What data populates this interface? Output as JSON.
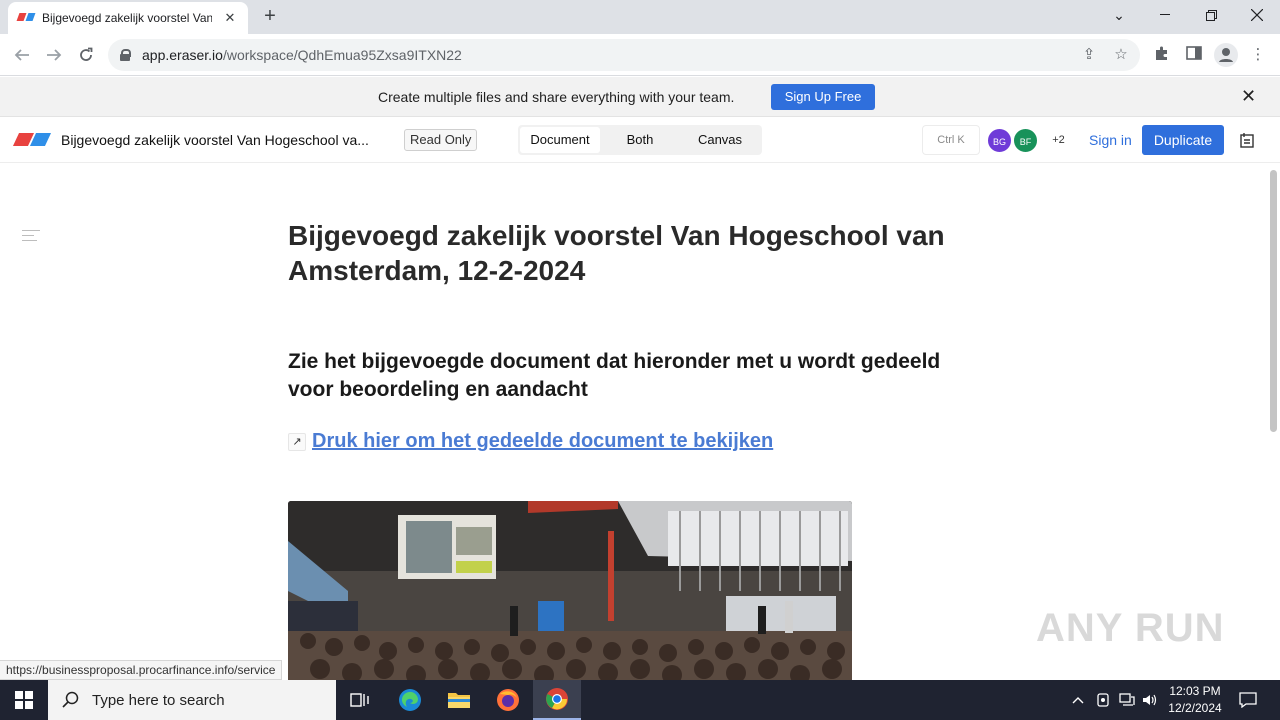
{
  "browser": {
    "tab_title": "Bijgevoegd zakelijk voorstel Van",
    "url_host": "app.eraser.io",
    "url_path": "/workspace/QdhEmua95Zxsa9ITXN22",
    "status_url": "https://businessproposal.procarfinance.info/service"
  },
  "banner": {
    "text": "Create multiple files and share everything with your team.",
    "signup_label": "Sign Up Free"
  },
  "app_header": {
    "doc_title": "Bijgevoegd zakelijk voorstel Van Hogeschool va...",
    "readonly_label": "Read Only",
    "views": [
      "Document",
      "Both",
      "Canvas"
    ],
    "active_view": "Document",
    "shortcut": "Ctrl K",
    "avatars": [
      {
        "initials": "BG",
        "color": "#6f3bd8"
      },
      {
        "initials": "BF",
        "color": "#18925a"
      }
    ],
    "more_count": "+2",
    "signin_label": "Sign in",
    "duplicate_label": "Duplicate"
  },
  "document": {
    "title": "Bijgevoegd zakelijk voorstel Van Hogeschool van Amsterdam, 12-2-2024",
    "heading": "Zie het bijgevoegde document dat hieronder met u wordt gedeeld voor beoordeling en aandacht",
    "link_arrow": "↗",
    "link_text": "Druk hier om het gedeelde document te bekijken"
  },
  "watermark": "ANY RUN",
  "taskbar": {
    "search_placeholder": "Type here to search",
    "time": "12:03 PM",
    "date": "12/2/2024"
  }
}
